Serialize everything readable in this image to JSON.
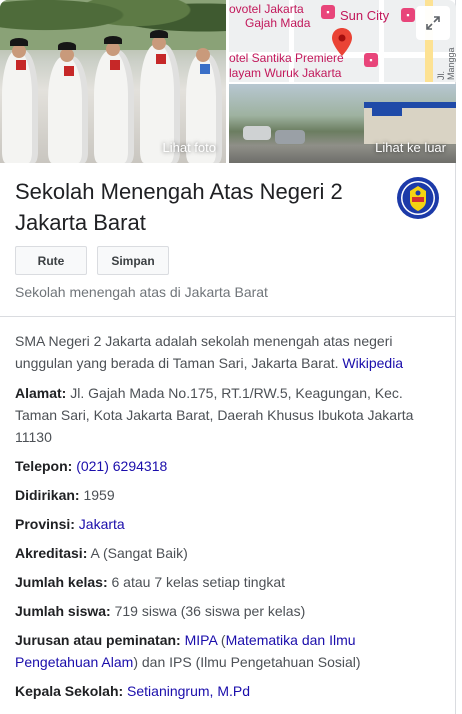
{
  "images": {
    "photo_label": "Lihat foto",
    "street_label": "Lihat ke luar",
    "map_labels": {
      "novotel": "ovotel Jakarta",
      "gajah_mada": "Gajah Mada",
      "sun_city": "Sun City",
      "street_top": "Jl. Ma",
      "santika": "otel Santika Premiere",
      "hayam_wuruk": "layam Wuruk Jakarta",
      "street_side": "Jl. Mangga Besar"
    }
  },
  "header": {
    "title_line1": "Sekolah Menengah Atas Negeri 2",
    "title_line2": "Jakarta Barat",
    "route_button": "Rute",
    "save_button": "Simpan",
    "subtitle": "Sekolah menengah atas di Jakarta Barat"
  },
  "description": {
    "text": "SMA Negeri 2 Jakarta adalah sekolah menengah atas negeri unggulan yang berada di Taman Sari, Jakarta Barat.",
    "source_link": "Wikipedia"
  },
  "attributes": {
    "address": {
      "label": "Alamat:",
      "value": "Jl. Gajah Mada No.175, RT.1/RW.5, Keagungan, Kec. Taman Sari, Kota Jakarta Barat, Daerah Khusus Ibukota Jakarta 11130"
    },
    "phone": {
      "label": "Telepon:",
      "value": "(021) 6294318"
    },
    "founded": {
      "label": "Didirikan:",
      "value": "1959"
    },
    "province": {
      "label": "Provinsi:",
      "value": "Jakarta"
    },
    "accreditation": {
      "label": "Akreditasi:",
      "value": "A (Sangat Baik)"
    },
    "classes": {
      "label": "Jumlah kelas:",
      "value": "6 atau 7 kelas setiap tingkat"
    },
    "students": {
      "label": "Jumlah siswa:",
      "value": "719 siswa (36 siswa per kelas)"
    },
    "majors": {
      "label": "Jurusan atau peminatan:",
      "link1": "MIPA",
      "open_paren": "(",
      "link2": "Matematika dan Ilmu Pengetahuan Alam",
      "rest": ") dan IPS (Ilmu Pengetahuan Sosial)"
    },
    "principal": {
      "label": "Kepala Sekolah:",
      "value": "Setianingrum, M.Pd"
    }
  },
  "colors": {
    "link": "#1a0dab",
    "text": "#4d5156",
    "title": "#202124",
    "map_poi": "#e8457a",
    "pin": "#ea4335"
  },
  "icons": [
    "expand-icon",
    "map-pin-icon",
    "school-logo"
  ]
}
